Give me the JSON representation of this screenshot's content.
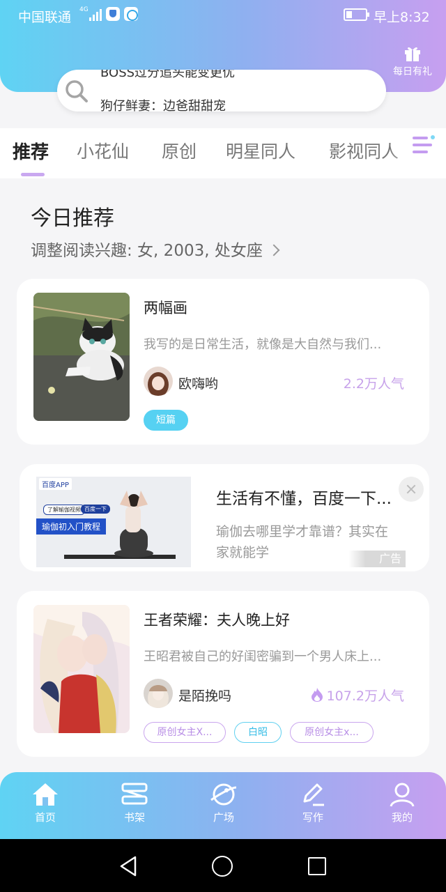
{
  "status_bar": {
    "carrier": "中国联通",
    "network": "4G",
    "time": "早上8:32",
    "battery_level": 0.3
  },
  "header": {
    "gift_label": "每日有礼",
    "search": {
      "ticker_previous": "BOSS过分追头能变更优",
      "ticker": "狗仔鲜妻：边爸甜甜宠"
    }
  },
  "tabs": [
    {
      "label": "推荐",
      "active": true
    },
    {
      "label": "小花仙",
      "active": false
    },
    {
      "label": "原创",
      "active": false
    },
    {
      "label": "明星同人",
      "active": false
    },
    {
      "label": "影视同人",
      "active": false
    }
  ],
  "section": {
    "title": "今日推荐",
    "subtitle": "调整阅读兴趣: 女, 2003, 处女座"
  },
  "books": [
    {
      "title": "两幅画",
      "desc": "我写的是日常生活，就像是大自然与我们...",
      "author": "欧嗨哟",
      "popularity": "2.2万人气",
      "hot": false,
      "tags": [
        {
          "label": "短篇",
          "style": "solid"
        }
      ]
    },
    {
      "title": "王者荣耀：夫人晚上好",
      "desc": "王昭君被自己的好闺密骗到一个男人床上...",
      "author": "是陌挽吗",
      "popularity": "107.2万人气",
      "hot": true,
      "tags": [
        {
          "label": "原创女主X...",
          "style": "purple"
        },
        {
          "label": "白昭",
          "style": "cyan"
        },
        {
          "label": "原创女主x...",
          "style": "purple"
        }
      ]
    }
  ],
  "ad": {
    "brand": "百度APP",
    "img_chip_left": "了解瑜伽视频",
    "img_chip_right": "百度一下",
    "img_caption": "瑜伽初入门教程",
    "title": "生活有不懂，百度一下...",
    "desc": "瑜伽去哪里学才靠谱？其实在家就能学",
    "label": "广告"
  },
  "bottom_nav": [
    {
      "label": "首页",
      "icon": "home-icon"
    },
    {
      "label": "书架",
      "icon": "bookshelf-icon"
    },
    {
      "label": "广场",
      "icon": "planet-icon"
    },
    {
      "label": "写作",
      "icon": "pen-icon"
    },
    {
      "label": "我的",
      "icon": "user-icon"
    }
  ],
  "colors": {
    "gradient_start": "#5fd3f3",
    "gradient_end": "#c79ff0",
    "accent_purple": "#c49cf0",
    "accent_cyan": "#56d1f2"
  }
}
